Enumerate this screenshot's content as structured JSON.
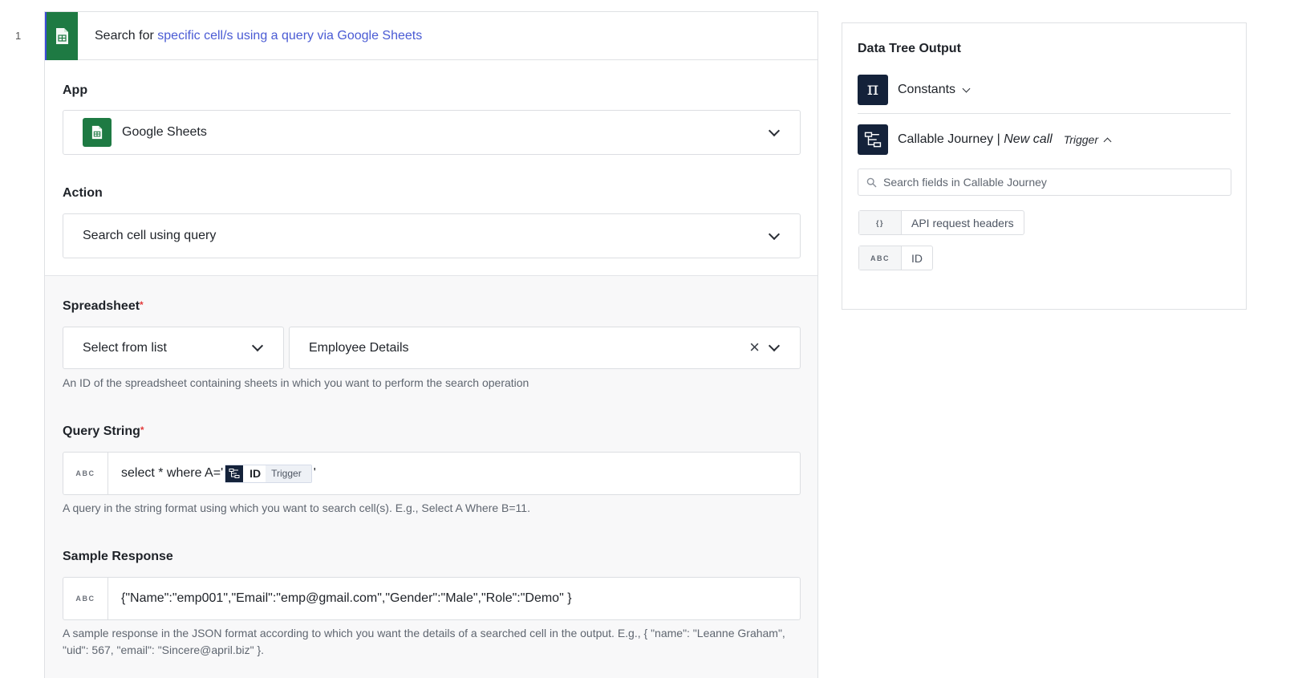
{
  "step": {
    "number": "1",
    "title_prefix": "Search for ",
    "title_accent": "specific cell/s using a query via Google Sheets",
    "brand_color": "#1e7a43",
    "accent_color": "#4a5bd4"
  },
  "app_field": {
    "label": "App",
    "value": "Google Sheets"
  },
  "action_field": {
    "label": "Action",
    "value": "Search cell using query"
  },
  "spreadsheet": {
    "label": "Spreadsheet",
    "required_mark": "*",
    "mode": "Select from list",
    "value": "Employee Details",
    "clear_symbol": "×",
    "helper": "An ID of the spreadsheet containing sheets in which you want to perform the search operation"
  },
  "query_string": {
    "label": "Query String",
    "required_mark": "*",
    "type_tag": "ABC",
    "prefix": "select * where A='",
    "chip_name": "ID",
    "chip_tag": "Trigger",
    "suffix": "'",
    "helper": "A query in the string format using which you want to search cell(s). E.g., Select A Where B=11."
  },
  "sample_response": {
    "label": "Sample Response",
    "type_tag": "ABC",
    "value": "{\"Name\":\"emp001\",\"Email\":\"emp@gmail.com\",\"Gender\":\"Male\",\"Role\":\"Demo\" }",
    "helper": "A sample response in the JSON format according to which you want the details of a searched cell in the output. E.g., { \"name\": \"Leanne Graham\", \"uid\": 567, \"email\": \"Sincere@april.biz\" }."
  },
  "data_tree": {
    "title": "Data Tree Output",
    "constants": {
      "label": "Constants",
      "icon_glyph": "π"
    },
    "callable": {
      "label": "Callable Journey",
      "separator": " | ",
      "call": "New call",
      "trigger": "Trigger"
    },
    "search_placeholder": "Search fields in Callable Journey",
    "fields": [
      {
        "tag": "{}",
        "name": "API request headers"
      },
      {
        "tag": "ABC",
        "name": "ID"
      }
    ]
  }
}
